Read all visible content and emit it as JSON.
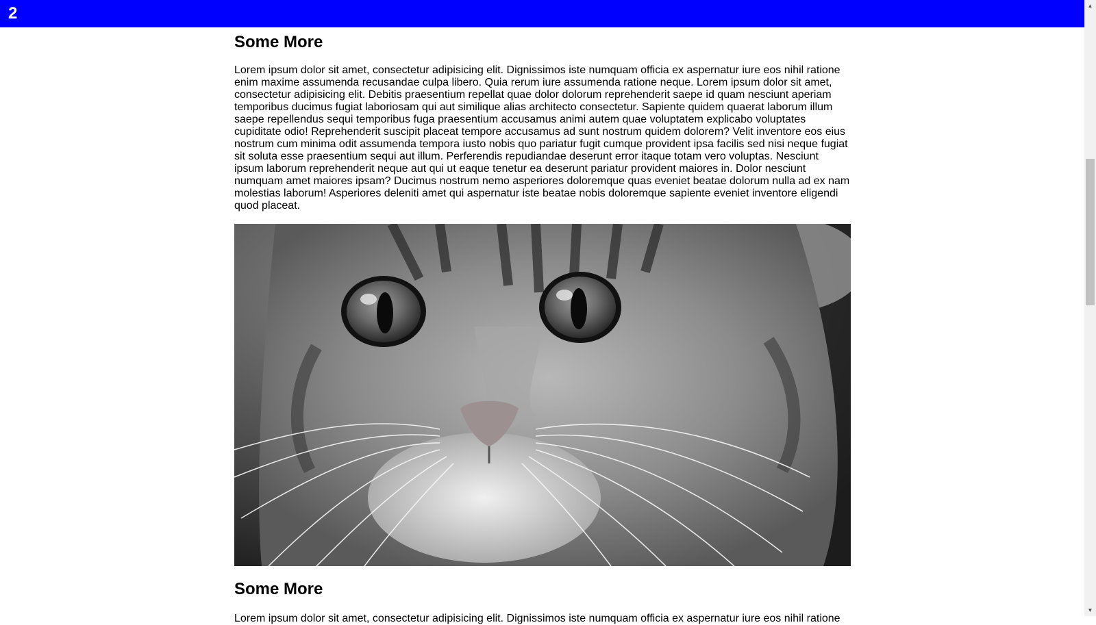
{
  "header": {
    "number": "2",
    "background_color": "#0000ff"
  },
  "sections": [
    {
      "heading": "Some More",
      "paragraph": "Lorem ipsum dolor sit amet, consectetur adipisicing elit. Dignissimos iste numquam officia ex aspernatur iure eos nihil ratione enim maxime assumenda recusandae culpa libero. Quia rerum iure assumenda ratione neque. Lorem ipsum dolor sit amet, consectetur adipisicing elit. Debitis praesentium repellat quae dolor dolorum reprehenderit saepe id quam nesciunt aperiam temporibus ducimus fugiat laboriosam qui aut similique alias architecto consectetur. Sapiente quidem quaerat laborum illum saepe repellendus sequi temporibus fuga praesentium accusamus animi autem quae voluptatem explicabo voluptates cupiditate odio! Reprehenderit suscipit placeat tempore accusamus ad sunt nostrum quidem dolorem? Velit inventore eos eius nostrum cum minima odit assumenda tempora iusto nobis quo pariatur fugit cumque provident ipsa facilis sed nisi neque fugiat sit soluta esse praesentium sequi aut illum. Perferendis repudiandae deserunt error itaque totam vero voluptas. Nesciunt ipsum laborum reprehenderit neque aut qui ut eaque tenetur ea deserunt pariatur provident maiores in. Dolor nesciunt numquam amet maiores ipsam? Ducimus nostrum nemo asperiores doloremque quas eveniet beatae dolorum nulla ad ex nam molestias laborum! Asperiores deleniti amet qui aspernatur iste beatae nobis doloremque sapiente eveniet inventore eligendi quod placeat."
    },
    {
      "heading": "Some More",
      "paragraph": "Lorem ipsum dolor sit amet, consectetur adipisicing elit. Dignissimos iste numquam officia ex aspernatur iure eos nihil ratione"
    }
  ],
  "image": {
    "icon": "cat-photo",
    "style": "grayscale"
  },
  "scrollbar": {
    "up_icon": "▲",
    "down_icon": "▼"
  }
}
